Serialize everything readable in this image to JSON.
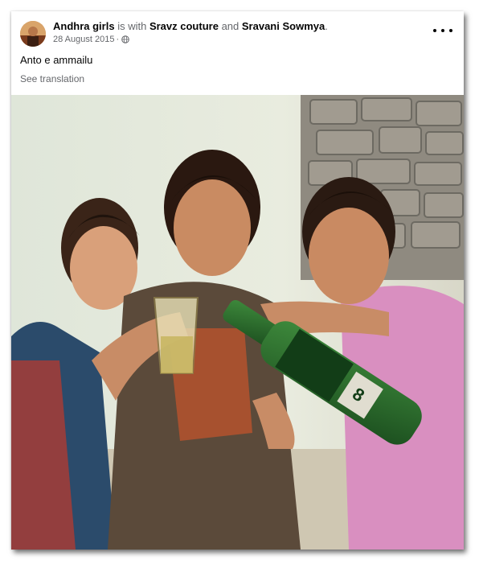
{
  "post": {
    "author": "Andhra girls",
    "with_text": "is with",
    "tag1": "Sravz couture",
    "and_text": "and",
    "tag2": "Sravani Sowmya",
    "period": ".",
    "date": "28 August 2015",
    "dot": "·",
    "privacy_icon": "globe-icon",
    "caption": "Anto e ammailu",
    "see_translation": "See translation"
  },
  "colors": {
    "primary_text": "#050505",
    "secondary_text": "#65676b",
    "card_bg": "#ffffff"
  }
}
